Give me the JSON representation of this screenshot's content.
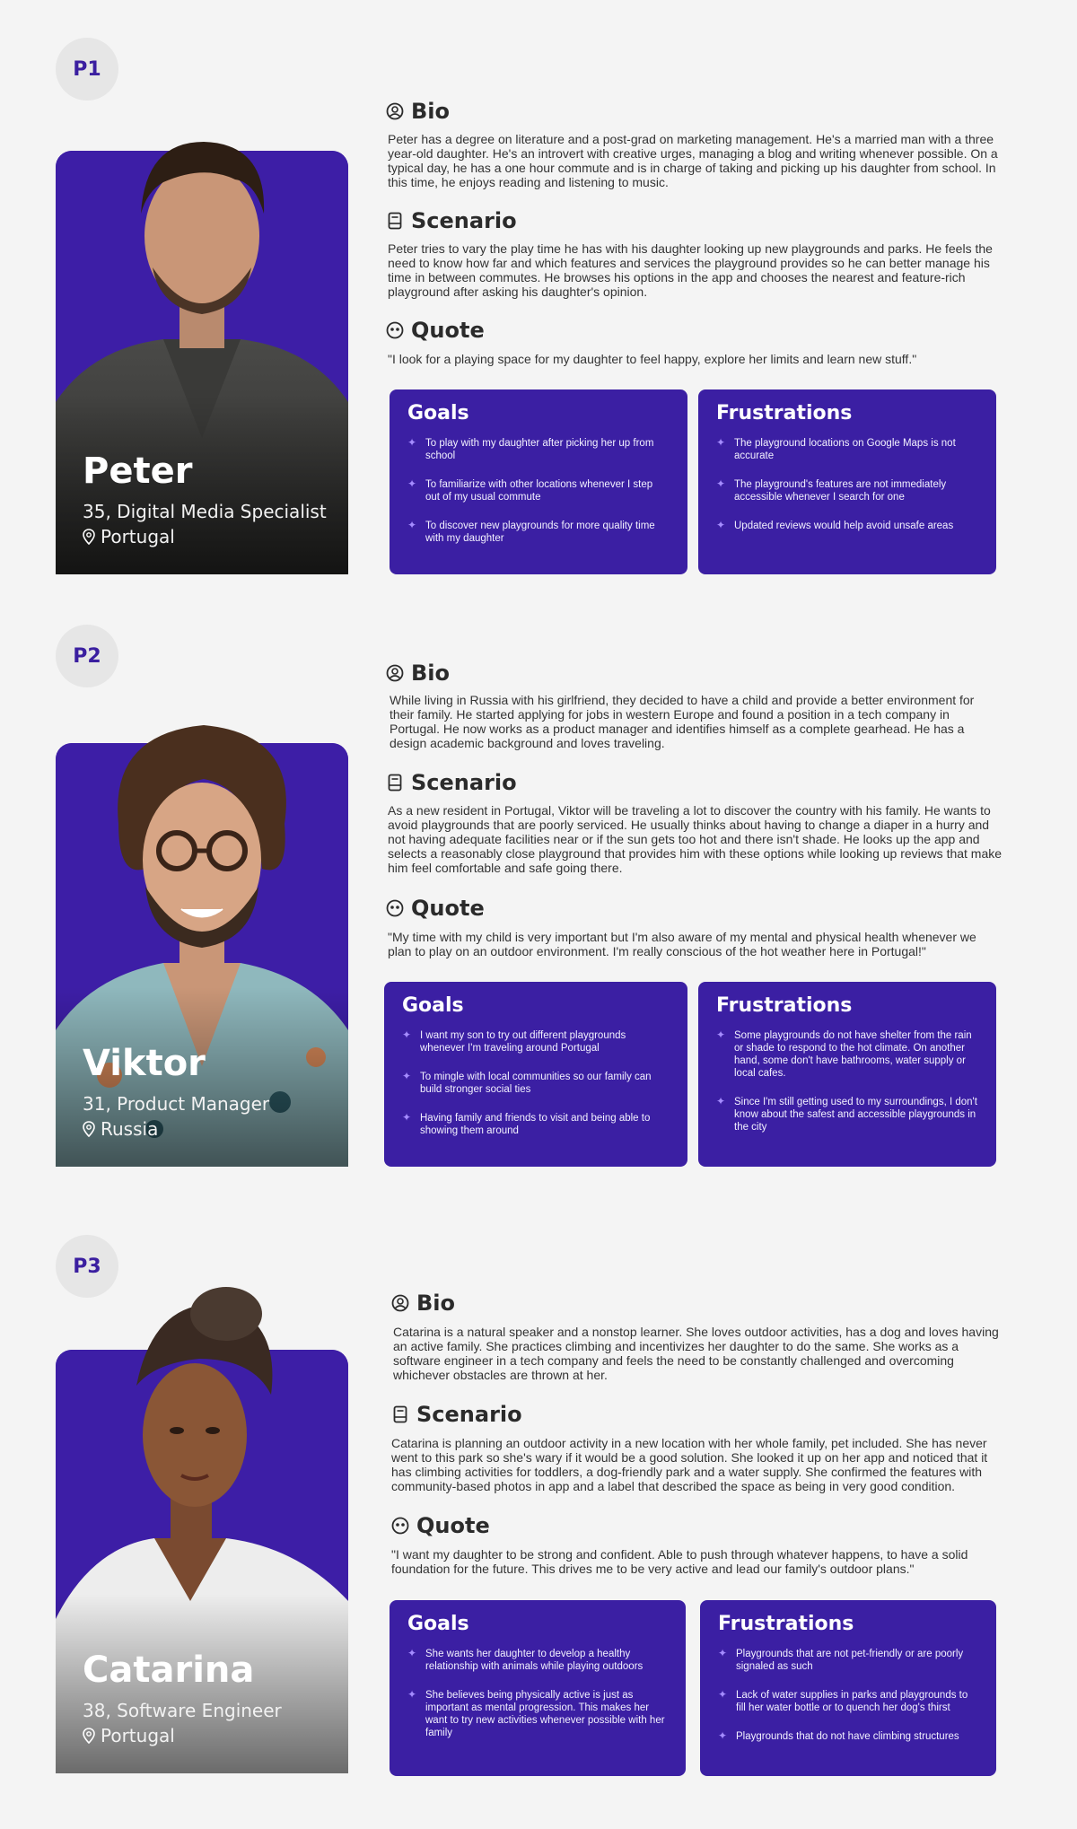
{
  "personas": [
    {
      "badge": "P1",
      "name": "Peter",
      "role": "35, Digital Media Specialist",
      "location": "Portugal",
      "bio_title": "Bio",
      "bio": "Peter has a degree on literature and a post-grad on marketing management. He's a married man with a three year-old daughter. He's an introvert with creative urges, managing a blog and writing whenever possible. On a typical day, he has a one hour commute and is in charge of taking and picking up his daughter from school. In this time, he enjoys reading and listening to music.",
      "scenario_title": "Scenario",
      "scenario": "Peter tries to vary the play time he has with his daughter looking up new playgrounds and parks. He feels the need to know how far and which features and services the playground provides so he can better manage his time in between commutes. He browses his options in the app and chooses the nearest and feature-rich playground after asking his daughter's opinion.",
      "quote_title": "Quote",
      "quote": "\"I look for a playing space for my daughter to feel happy, explore her limits and learn new stuff.\"",
      "goals_title": "Goals",
      "goals": [
        "To play with my daughter after picking her up from school",
        "To familiarize with other locations whenever I step out of my usual commute",
        "To discover new playgrounds for more quality time with my daughter"
      ],
      "frustrations_title": "Frustrations",
      "frustrations": [
        "The playground locations on Google Maps is not accurate",
        "The playground's features are not immediately accessible whenever I search for one",
        "Updated reviews would help avoid unsafe areas"
      ]
    },
    {
      "badge": "P2",
      "name": "Viktor",
      "role": "31, Product Manager",
      "location": "Russia",
      "bio_title": "Bio",
      "bio": "While living in Russia with his girlfriend, they decided to have a child and provide a better environment for their family. He started applying for jobs in western Europe and found a position in a tech company in Portugal. He now works as a product manager and identifies himself as a complete gearhead. He has a design academic background and loves traveling.",
      "scenario_title": "Scenario",
      "scenario": "As a new resident in Portugal, Viktor will be traveling a lot to discover the country with his family. He wants to avoid playgrounds that are poorly serviced. He usually thinks about having to change a diaper in a hurry and not having adequate facilities near or if the sun gets too hot and there isn't shade. He looks up the app and selects a reasonably close playground that provides him with these options while looking up reviews that make him feel comfortable and safe going there.",
      "quote_title": "Quote",
      "quote": "\"My time with my child is very important but I'm also aware of my mental and physical health whenever we plan to play on an outdoor environment. I'm really conscious of the hot weather here in Portugal!\"",
      "goals_title": "Goals",
      "goals": [
        "I want my son to try out different playgrounds whenever I'm traveling around Portugal",
        "To mingle with local communities so our family can build stronger social ties",
        "Having family and friends to visit and being able to showing them around"
      ],
      "frustrations_title": "Frustrations",
      "frustrations": [
        "Some playgrounds do not have shelter from the rain or shade to respond to the hot climate. On another hand, some don't have bathrooms, water supply or local cafes.",
        "Since I'm still getting used to my surroundings, I don't know about the safest and accessible playgrounds in the city"
      ]
    },
    {
      "badge": "P3",
      "name": "Catarina",
      "role": "38, Software Engineer",
      "location": "Portugal",
      "bio_title": "Bio",
      "bio": "Catarina is a natural speaker and a nonstop learner. She loves outdoor activities, has a dog and loves having an active family. She practices climbing and incentivizes her daughter to do the same. She works as a software engineer in a tech company and feels the need to be constantly challenged and overcoming whichever obstacles are thrown at her.",
      "scenario_title": "Scenario",
      "scenario": "Catarina is planning an outdoor activity in a new location with her whole family, pet included. She has never went to this park so she's wary if it would be a good solution. She looked it up on her app and noticed that it has climbing activities for toddlers, a dog-friendly park and a water supply. She confirmed the features with community-based photos in app and a label that described the space as being in very good condition.",
      "quote_title": "Quote",
      "quote": "\"I want my daughter to be strong and confident. Able to push through whatever happens, to have a solid foundation for the future. This drives me to be very active and lead our family's outdoor plans.\"",
      "goals_title": "Goals",
      "goals": [
        "She wants her daughter to develop a healthy relationship with animals while playing outdoors",
        "She believes being physically active is just as important as mental progression. This makes her want to try new activities whenever possible with her family"
      ],
      "frustrations_title": "Frustrations",
      "frustrations": [
        "Playgrounds that are not pet-friendly or are poorly signaled as such",
        "Lack of water supplies in parks and playgrounds to fill her water bottle or to quench her dog's thirst",
        "Playgrounds that do not have climbing structures"
      ]
    }
  ],
  "colors": {
    "accent": "#3d1ea6",
    "background": "#f4f4f4",
    "badge_bg": "#e6e6e6",
    "sparkle": "#a58cff"
  },
  "icons": {
    "bio": "user-circle-icon",
    "scenario": "book-icon",
    "quote": "quote-bubble-icon",
    "location": "map-pin-icon",
    "bullet": "sparkle-icon"
  }
}
